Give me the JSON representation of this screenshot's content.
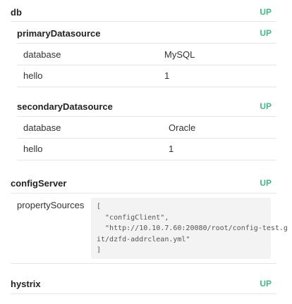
{
  "db": {
    "title": "db",
    "status": "UP",
    "primary": {
      "title": "primaryDatasource",
      "status": "UP",
      "rows": [
        {
          "label": "database",
          "value": "MySQL"
        },
        {
          "label": "hello",
          "value": "1"
        }
      ]
    },
    "secondary": {
      "title": "secondaryDatasource",
      "status": "UP",
      "rows": [
        {
          "label": "database",
          "value": "Oracle"
        },
        {
          "label": "hello",
          "value": "1"
        }
      ]
    }
  },
  "configServer": {
    "title": "configServer",
    "status": "UP",
    "label": "propertySources",
    "code_lines": [
      "[",
      "  \"configClient\",",
      "  \"http://10.10.7.60:20080/root/config-test.g",
      "it/dzfd-addrclean.yml\"",
      "]"
    ]
  },
  "hystrix": {
    "title": "hystrix",
    "status": "UP"
  }
}
